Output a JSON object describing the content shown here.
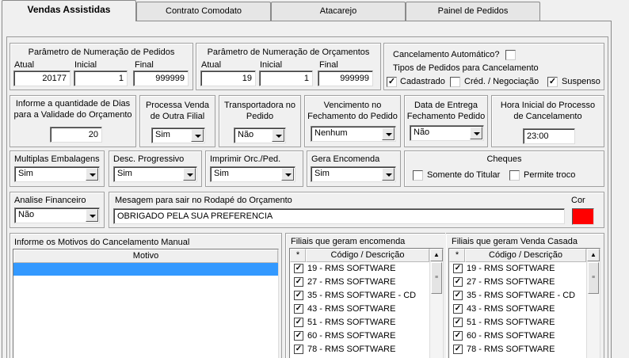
{
  "tabs": [
    "Vendas Assistidas",
    "Contrato Comodato",
    "Atacarejo",
    "Painel de Pedidos"
  ],
  "numeracao_pedidos": {
    "title": "Parâmetro de Numeração de Pedidos",
    "atual_label": "Atual",
    "inicial_label": "Inicial",
    "final_label": "Final",
    "atual": "20177",
    "inicial": "1",
    "final": "999999"
  },
  "numeracao_orcamentos": {
    "title": "Parâmetro de Numeração de Orçamentos",
    "atual_label": "Atual",
    "inicial_label": "Inicial",
    "final_label": "Final",
    "atual": "19",
    "inicial": "1",
    "final": "999999"
  },
  "cancelamento": {
    "auto_label": "Cancelamento Automático?",
    "auto_checked": false,
    "tipos_label": "Tipos de Pedidos para Cancelamento",
    "cadastrado_label": "Cadastrado",
    "cadastrado_checked": true,
    "cred_label": "Créd. / Negociação",
    "cred_checked": false,
    "suspenso_label": "Suspenso",
    "suspenso_checked": true
  },
  "validade": {
    "label1": "Informe a quantidade de Dias",
    "label2": "para a Validade do Orçamento",
    "value": "20"
  },
  "processa_venda": {
    "label1": "Processa Venda",
    "label2": "de Outra Filial",
    "value": "Sim"
  },
  "transportadora": {
    "label1": "Transportadora no",
    "label2": "Pedido",
    "value": "Não"
  },
  "vencimento": {
    "label1": "Vencimento no",
    "label2": "Fechamento do Pedido",
    "value": "Nenhum"
  },
  "data_entrega": {
    "label1": "Data de Entrega",
    "label2": "Fechamento Pedido",
    "value": "Não"
  },
  "hora_inicial": {
    "label1": "Hora Inicial do Processo",
    "label2": "de Cancelamento",
    "value": "23:00"
  },
  "multiplas_embalagens": {
    "label": "Multiplas Embalagens",
    "value": "Sim"
  },
  "desc_progressivo": {
    "label": "Desc. Progressivo",
    "value": "Sim"
  },
  "imprimir": {
    "label": "Imprimir Orc./Ped.",
    "value": "Sim"
  },
  "gera_encomenda": {
    "label": "Gera Encomenda",
    "value": "Sim"
  },
  "cheques": {
    "title": "Cheques",
    "somente_titular_label": "Somente do Titular",
    "somente_titular_checked": false,
    "permite_troco_label": "Permite troco",
    "permite_troco_checked": false
  },
  "analise_financeiro": {
    "label": "Analise Financeiro",
    "value": "Não"
  },
  "mensagem": {
    "label": "Mesagem para sair no Rodapé do Orçamento",
    "value": "OBRIGADO PELA SUA PREFERENCIA"
  },
  "cor": {
    "label": "Cor",
    "color": "#ff0000"
  },
  "motivos": {
    "title": "Informe os Motivos do Cancelamento Manual",
    "column": "Motivo"
  },
  "filiais_encomenda": {
    "title": "Filiais que geram encomenda",
    "star": "*",
    "column": "Código / Descrição",
    "rows": [
      "19 - RMS SOFTWARE",
      "27 - RMS SOFTWARE",
      "35 - RMS SOFTWARE - CD",
      "43 - RMS SOFTWARE",
      "51 - RMS SOFTWARE",
      "60 - RMS SOFTWARE",
      "78 - RMS SOFTWARE"
    ]
  },
  "filiais_venda_casada": {
    "title": "Filiais que geram Venda Casada",
    "star": "*",
    "column": "Código / Descrição",
    "rows": [
      "19 - RMS SOFTWARE",
      "27 - RMS SOFTWARE",
      "35 - RMS SOFTWARE - CD",
      "43 - RMS SOFTWARE",
      "51 - RMS SOFTWARE",
      "60 - RMS SOFTWARE",
      "78 - RMS SOFTWARE"
    ]
  },
  "check_mark": "✓"
}
